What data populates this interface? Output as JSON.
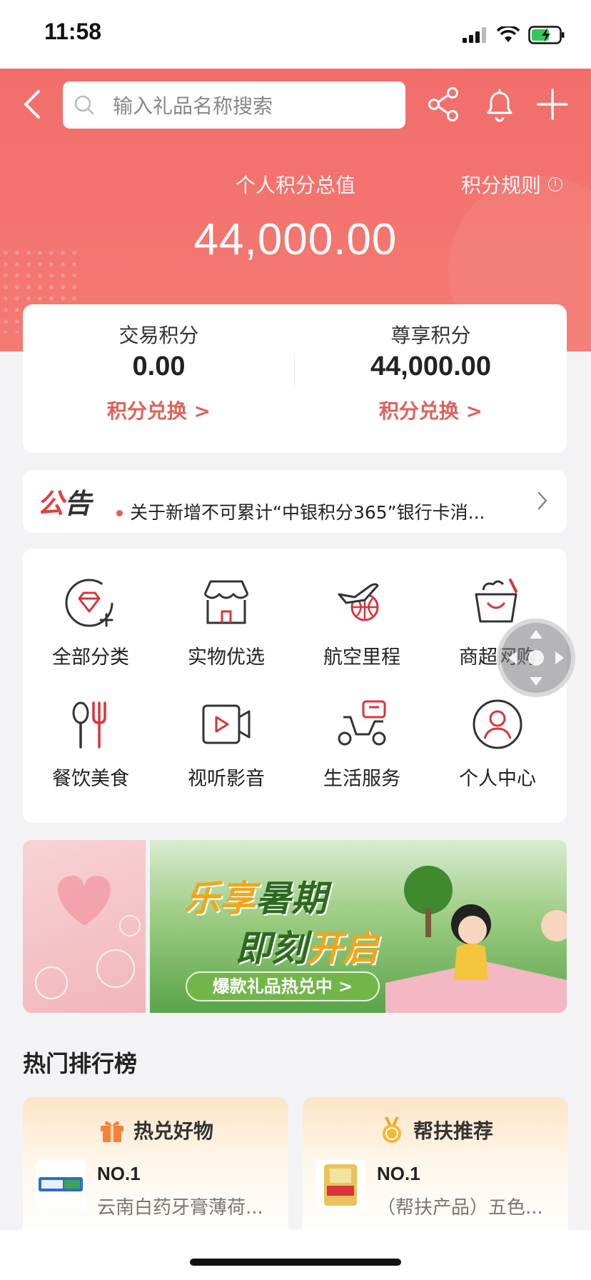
{
  "status_bar": {
    "time": "11:58"
  },
  "header": {
    "search_placeholder": "输入礼品名称搜索",
    "icons": [
      "back-icon",
      "search-icon",
      "share-icon",
      "bell-icon",
      "plus-icon"
    ]
  },
  "points_summary": {
    "title": "个人积分总值",
    "rule_label": "积分规则",
    "total": "44,000.00"
  },
  "points_cards": [
    {
      "label": "交易积分",
      "value": "0.00",
      "link": "积分兑换 >"
    },
    {
      "label": "尊享积分",
      "value": "44,000.00",
      "link": "积分兑换 >"
    }
  ],
  "notice": {
    "logo_text": "公告",
    "text": "关于新增不可累计“中银积分365”银行卡消..."
  },
  "categories": [
    {
      "label": "全部分类",
      "icon": "diamond-plus-icon"
    },
    {
      "label": "实物优选",
      "icon": "store-icon"
    },
    {
      "label": "航空里程",
      "icon": "airplane-globe-icon"
    },
    {
      "label": "商超网购",
      "icon": "shopping-bag-icon"
    },
    {
      "label": "餐饮美食",
      "icon": "spoon-fork-icon"
    },
    {
      "label": "视听影音",
      "icon": "video-camera-icon"
    },
    {
      "label": "生活服务",
      "icon": "scooter-icon"
    },
    {
      "label": "个人中心",
      "icon": "user-icon"
    }
  ],
  "banner": {
    "title_line1_a": "乐享",
    "title_line1_b": "暑期",
    "title_line2_a": "即刻",
    "title_line2_b": "开启",
    "cta": "爆款礼品热兑中 >"
  },
  "ranking": {
    "title": "热门排行榜",
    "lists": [
      {
        "title": "热兑好物",
        "icon": "gift-icon",
        "rank": "NO.1",
        "item": "云南白药牙膏薄荷..."
      },
      {
        "title": "帮扶推荐",
        "icon": "medal-icon",
        "rank": "NO.1",
        "item": "（帮扶产品）五色..."
      }
    ]
  },
  "colors": {
    "accent": "#f26e6b",
    "link": "#e0615b",
    "icon_red": "#d9343a"
  }
}
